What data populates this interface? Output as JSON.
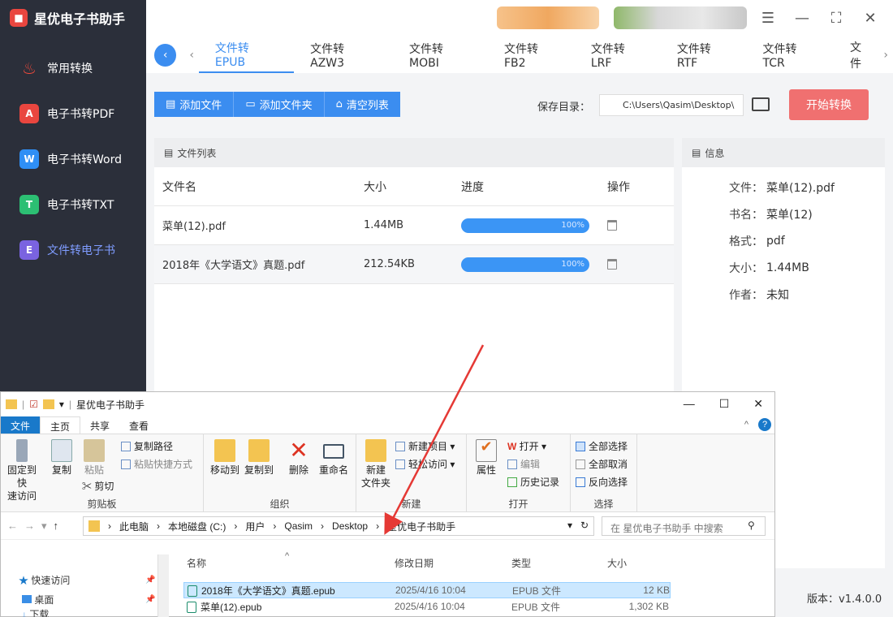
{
  "app": {
    "title": "星优电子书助手",
    "version": "版本：v1.4.0.0"
  },
  "sidebar": {
    "items": [
      {
        "label": "常用转换",
        "icon": "flame-icon",
        "color": "#f04a3c"
      },
      {
        "label": "电子书转PDF",
        "icon": "pdf-icon",
        "color": "#e9463f",
        "glyph": "A"
      },
      {
        "label": "电子书转Word",
        "icon": "word-icon",
        "color": "#2f8ff5",
        "glyph": "W"
      },
      {
        "label": "电子书转TXT",
        "icon": "txt-icon",
        "color": "#2cbf73",
        "glyph": "T"
      },
      {
        "label": "文件转电子书",
        "icon": "ebook-icon",
        "color": "#7a63e0",
        "glyph": "E"
      }
    ]
  },
  "tabs": [
    "文件转EPUB",
    "文件转AZW3",
    "文件转MOBI",
    "文件转FB2",
    "文件转LRF",
    "文件转RTF",
    "文件转TCR",
    "文件"
  ],
  "toolbar": {
    "add_file": "添加文件",
    "add_folder": "添加文件夹",
    "clear": "清空列表",
    "save_label": "保存目录：",
    "save_path": "C:\\Users\\Qasim\\Desktop\\",
    "start": "开始转换"
  },
  "filelist": {
    "title": "文件列表",
    "headers": [
      "文件名",
      "大小",
      "进度",
      "操作"
    ],
    "rows": [
      {
        "name": "菜单(12).pdf",
        "size": "1.44MB",
        "progress": "100%"
      },
      {
        "name": "2018年《大学语文》真题.pdf",
        "size": "212.54KB",
        "progress": "100%"
      }
    ]
  },
  "info": {
    "title": "信息",
    "fields": [
      [
        "文件：",
        "菜单(12).pdf"
      ],
      [
        "书名：",
        "菜单(12)"
      ],
      [
        "格式：",
        "pdf"
      ],
      [
        "大小：",
        "1.44MB"
      ],
      [
        "作者：",
        "未知"
      ]
    ]
  },
  "explorer": {
    "title": "星优电子书助手",
    "tabs": [
      "文件",
      "主页",
      "共享",
      "查看"
    ],
    "ribbon": {
      "pin": "固定到快\n速访问",
      "copy": "复制",
      "paste": "粘贴",
      "copy_path": "复制路径",
      "paste_shortcut": "粘贴快捷方式",
      "cut": "剪切",
      "clipboard": "剪贴板",
      "move_to": "移动到",
      "copy_to": "复制到",
      "delete": "删除",
      "rename": "重命名",
      "organize": "组织",
      "new_folder": "新建\n文件夹",
      "new_item": "新建项目",
      "easy_access": "轻松访问",
      "new": "新建",
      "properties": "属性",
      "open": "打开",
      "edit": "编辑",
      "history": "历史记录",
      "open_group": "打开",
      "select_all": "全部选择",
      "select_none": "全部取消",
      "invert": "反向选择",
      "select": "选择"
    },
    "address": [
      "此电脑",
      "本地磁盘 (C:)",
      "用户",
      "Qasim",
      "Desktop",
      "星优电子书助手"
    ],
    "search_placeholder": "在 星优电子书助手 中搜索",
    "nav": [
      "快速访问",
      "桌面",
      "下载"
    ],
    "columns": [
      "名称",
      "修改日期",
      "类型",
      "大小"
    ],
    "files": [
      {
        "name": "2018年《大学语文》真题.epub",
        "date": "2025/4/16 10:04",
        "type": "EPUB 文件",
        "size": "12 KB"
      },
      {
        "name": "菜单(12).epub",
        "date": "2025/4/16 10:04",
        "type": "EPUB 文件",
        "size": "1,302 KB"
      }
    ]
  },
  "annotation": {
    "color": "#e53935"
  }
}
